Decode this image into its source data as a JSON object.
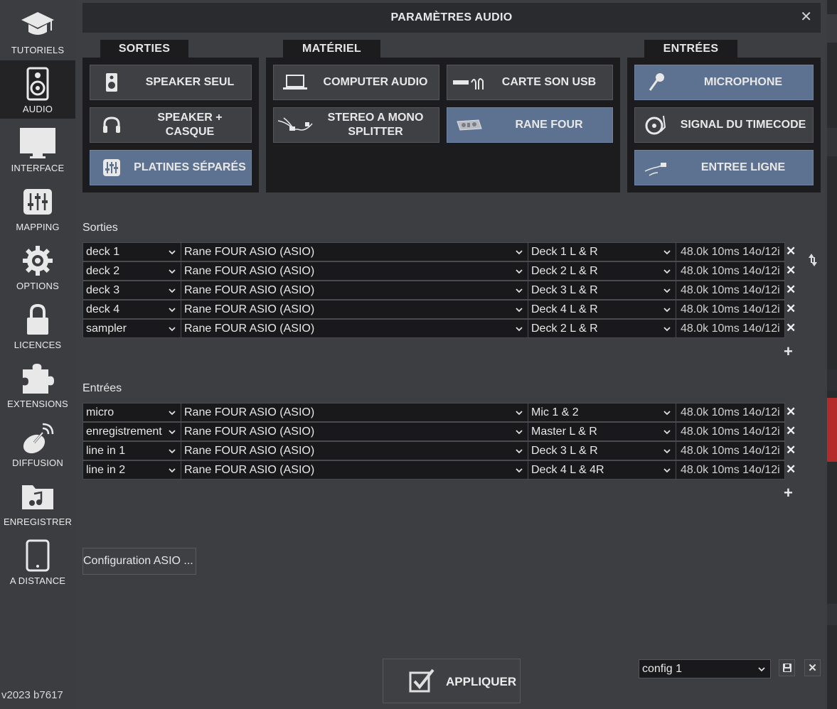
{
  "sidebar": {
    "items": [
      {
        "label": "TUTORIELS",
        "icon": "graduation-cap-icon"
      },
      {
        "label": "AUDIO",
        "icon": "speaker-icon",
        "active": true
      },
      {
        "label": "INTERFACE",
        "icon": "monitor-icon"
      },
      {
        "label": "MAPPING",
        "icon": "sliders-icon"
      },
      {
        "label": "OPTIONS",
        "icon": "gear-icon"
      },
      {
        "label": "LICENCES",
        "icon": "lock-icon"
      },
      {
        "label": "EXTENSIONS",
        "icon": "puzzle-icon"
      },
      {
        "label": "DIFFUSION",
        "icon": "satellite-dish-icon"
      },
      {
        "label": "ENREGISTRER",
        "icon": "music-folder-icon"
      },
      {
        "label": "A DISTANCE",
        "icon": "tablet-icon"
      }
    ],
    "version": "v2023 b7617"
  },
  "dialog": {
    "title": "PARAMÈTRES AUDIO",
    "close": "✕"
  },
  "groups": {
    "sorties": {
      "tab": "SORTIES",
      "buttons": [
        {
          "label": "SPEAKER SEUL",
          "icon": "speaker-icon"
        },
        {
          "label": "SPEAKER + CASQUE",
          "icon": "headphones-icon"
        },
        {
          "label": "PLATINES SÉPARÉS",
          "icon": "mixer-icon",
          "selected": true
        }
      ]
    },
    "materiel": {
      "tab": "MATÉRIEL",
      "buttons": [
        {
          "label": "COMPUTER AUDIO",
          "icon": "laptop-icon"
        },
        {
          "label": "CARTE SON USB",
          "icon": "usb-card-icon"
        },
        {
          "label": "STEREO A MONO SPLITTER",
          "icon": "splitter-cable-icon"
        },
        {
          "label": "RANE FOUR",
          "icon": "controller-icon",
          "selected": true
        }
      ]
    },
    "entrees": {
      "tab": "ENTRÉES",
      "buttons": [
        {
          "label": "MICROPHONE",
          "icon": "microphone-icon",
          "selected": true
        },
        {
          "label": "SIGNAL DU TIMECODE",
          "icon": "turntable-icon"
        },
        {
          "label": "ENTREE LIGNE",
          "icon": "line-cable-icon"
        }
      ]
    }
  },
  "outputs": {
    "title": "Sorties",
    "rows": [
      {
        "name": "deck 1",
        "device": "Rane FOUR ASIO (ASIO)",
        "channel": "Deck 1 L & R",
        "info": "48.0k 10ms 14o/12i"
      },
      {
        "name": "deck 2",
        "device": "Rane FOUR ASIO (ASIO)",
        "channel": "Deck 2 L & R",
        "info": "48.0k 10ms 14o/12i"
      },
      {
        "name": "deck 3",
        "device": "Rane FOUR ASIO (ASIO)",
        "channel": "Deck 3 L & R",
        "info": "48.0k 10ms 14o/12i"
      },
      {
        "name": "deck 4",
        "device": "Rane FOUR ASIO (ASIO)",
        "channel": "Deck 4 L & R",
        "info": "48.0k 10ms 14o/12i"
      },
      {
        "name": "sampler",
        "device": "Rane FOUR ASIO (ASIO)",
        "channel": "Deck 2 L & R",
        "info": "48.0k 10ms 14o/12i"
      }
    ]
  },
  "inputs": {
    "title": "Entrées",
    "rows": [
      {
        "name": "micro",
        "device": "Rane FOUR ASIO (ASIO)",
        "channel": "Mic 1 & 2",
        "info": "48.0k 10ms 14o/12i"
      },
      {
        "name": "enregistrement",
        "device": "Rane FOUR ASIO (ASIO)",
        "channel": "Master L & R",
        "info": "48.0k 10ms 14o/12i"
      },
      {
        "name": "line in 1",
        "device": "Rane FOUR ASIO (ASIO)",
        "channel": "Deck 3 L & R",
        "info": "48.0k 10ms 14o/12i"
      },
      {
        "name": "line in 2",
        "device": "Rane FOUR ASIO (ASIO)",
        "channel": "Deck 4 L & 4R",
        "info": "48.0k 10ms 14o/12i"
      }
    ]
  },
  "row_delete": "✕",
  "add": "+",
  "asio_button": "Configuration ASIO ...",
  "apply_button": "APPLIQUER",
  "config": {
    "selected": "config 1",
    "delete": "✕"
  },
  "colors": {
    "selected_button": "#5d7190",
    "panel_bg": "#3d3e42",
    "group_bg": "#1c1c1e"
  }
}
